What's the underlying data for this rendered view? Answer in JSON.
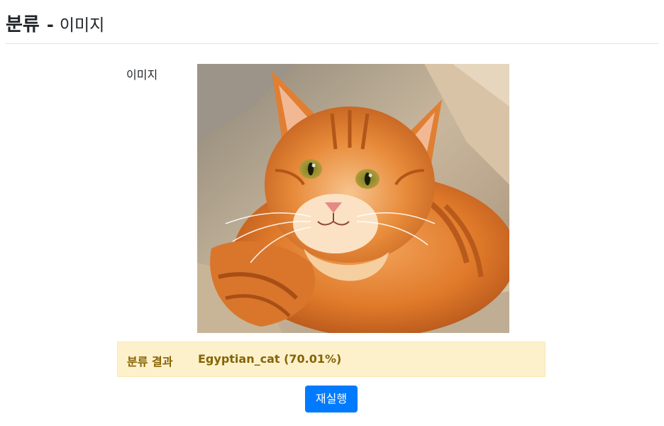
{
  "header": {
    "title": "분류",
    "separator": "-",
    "subtitle": "이미지"
  },
  "form": {
    "image_label": "이미지",
    "image_subject": "orange tabby cat"
  },
  "result": {
    "label": "분류 결과",
    "value": "Egyptian_cat (70.01%)"
  },
  "actions": {
    "rerun_label": "재실행"
  },
  "colors": {
    "primary_button": "#007bff",
    "result_background": "#fdf1cc",
    "result_text": "#856404",
    "divider": "#e3e3e3"
  }
}
